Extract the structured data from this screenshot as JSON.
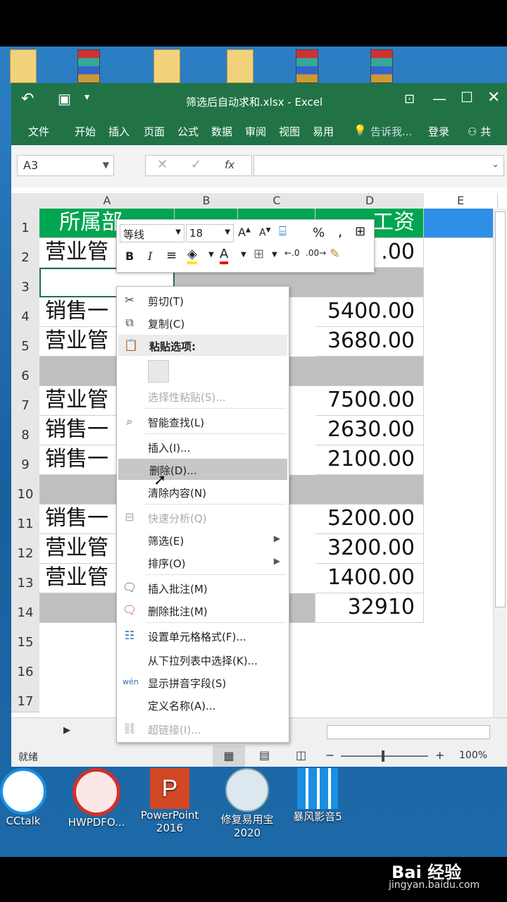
{
  "window": {
    "title": "筛选后自动求和.xlsx - Excel"
  },
  "ribbon": {
    "tabs": [
      "文件",
      "开始",
      "插入",
      "页面",
      "公式",
      "数据",
      "审阅",
      "视图",
      "易用"
    ],
    "tell_me": "告诉我...",
    "login": "登录",
    "share": "共"
  },
  "formula_bar": {
    "name_box": "A3",
    "fx": "fx",
    "cancel": "✕",
    "enter": "✓"
  },
  "columns": [
    "A",
    "B",
    "C",
    "D",
    "E"
  ],
  "rows": [
    "1",
    "2",
    "3",
    "4",
    "5",
    "6",
    "7",
    "8",
    "9",
    "10",
    "11",
    "12",
    "13",
    "14",
    "15",
    "16",
    "17"
  ],
  "cells": {
    "header_a": "所属部",
    "header_d": "工资",
    "a2": "营业管",
    "a4": "销售一",
    "a5": "营业管",
    "a7": "营业管",
    "a8": "销售一",
    "a9": "销售一",
    "a11": "销售一",
    "a12": "营业管",
    "a13": "营业管",
    "d2": ".00",
    "d4": "5400.00",
    "d5": "3680.00",
    "d7": "7500.00",
    "d8": "2630.00",
    "d9": "2100.00",
    "d11": "5200.00",
    "d12": "3200.00",
    "d13": "1400.00",
    "d14": "32910"
  },
  "mini_toolbar": {
    "font": "等线",
    "size": "18",
    "bold": "B",
    "italic": "I",
    "percent": "%",
    "comma": ","
  },
  "context_menu": {
    "cut": "剪切(T)",
    "copy": "复制(C)",
    "paste_options": "粘贴选项:",
    "paste_special": "选择性粘贴(S)...",
    "smart_lookup": "智能查找(L)",
    "insert": "插入(I)...",
    "delete": "删除(D)...",
    "clear": "清除内容(N)",
    "quick_analysis": "快速分析(Q)",
    "filter": "筛选(E)",
    "sort": "排序(O)",
    "insert_comment": "插入批注(M)",
    "delete_comment": "删除批注(M)",
    "format_cells": "设置单元格格式(F)...",
    "pick_list": "从下拉列表中选择(K)...",
    "phonetic": "显示拼音字段(S)",
    "define_name": "定义名称(A)...",
    "hyperlink": "超链接(I)..."
  },
  "status": {
    "ready": "就绪",
    "zoom": "100%"
  },
  "desktop_icons": [
    "CCtalk",
    "HWPDFO...",
    "PowerPoint 2016",
    "修复易用宝 2020",
    "暴风影音5"
  ],
  "watermark": {
    "brand": "Bai 经验",
    "url": "jingyan.baidu.com"
  },
  "colors": {
    "excel_green": "#217346",
    "header_green": "#00a651",
    "gray_row": "#bfbfbf"
  }
}
